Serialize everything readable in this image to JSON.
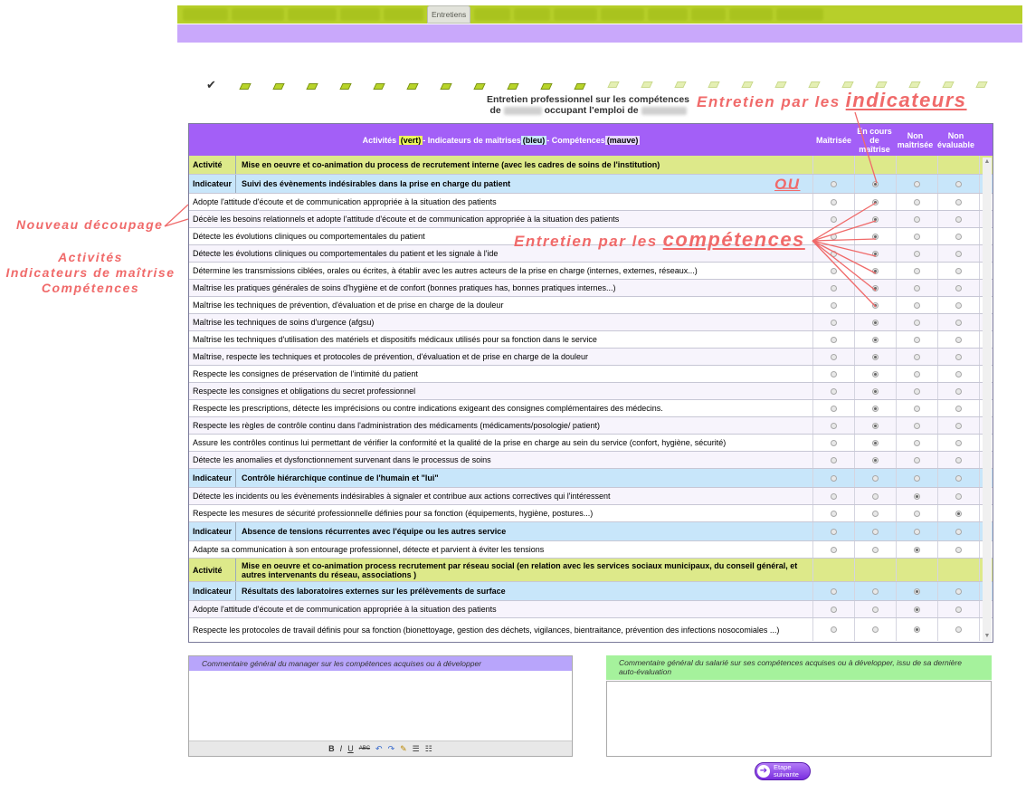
{
  "nav": {
    "tabs_blurred_count": 13,
    "active_tab": "Entretiens"
  },
  "header": {
    "line1": "Entretien professionnel sur les compétences",
    "line2_prefix": "de",
    "line2_mid": "occupant l'emploi de"
  },
  "table": {
    "title_prefix": "Activités",
    "title_hl1": "(vert)",
    "title_mid1": " - Indicateurs de maîtrises ",
    "title_hl2": "(bleu)",
    "title_mid2": " - Compétences ",
    "title_hl3": "(mauve)",
    "col_headers": [
      "Maîtrisée",
      "En cours de maîtrise",
      "Non maîtrisée",
      "Non évaluable"
    ],
    "rows": [
      {
        "type": "activite",
        "label": "Activité",
        "text": "Mise en oeuvre et co-animation du process de recrutement interne (avec les cadres de soins de l'institution)"
      },
      {
        "type": "indicateur",
        "label": "Indicateur",
        "text": "Suivi des évènements indésirables dans la prise en charge du patient",
        "sel": 1
      },
      {
        "type": "competence",
        "text": "Adopte l'attitude d'écoute et de communication appropriée à la situation des patients",
        "sel": 1
      },
      {
        "type": "competence",
        "text": "Décèle les besoins relationnels et adopte l'attitude d'écoute et de communication appropriée à la situation des patients",
        "sel": 1
      },
      {
        "type": "competence",
        "text": "Détecte les évolutions cliniques ou comportementales du patient",
        "sel": 1
      },
      {
        "type": "competence",
        "text": "Détecte les évolutions cliniques ou comportementales du patient et les signale à l'ide",
        "sel": 1
      },
      {
        "type": "competence",
        "text": "Détermine les transmissions ciblées, orales ou écrites, à établir avec les autres acteurs de la prise en charge (internes, externes, réseaux...)",
        "sel": 1
      },
      {
        "type": "competence",
        "text": "Maîtrise les pratiques générales de soins d'hygiène et de confort (bonnes pratiques has, bonnes pratiques internes...)",
        "sel": 1
      },
      {
        "type": "competence",
        "text": "Maîtrise les techniques de prévention, d'évaluation et de prise en charge de la douleur",
        "sel": 1
      },
      {
        "type": "competence",
        "text": "Maîtrise les techniques de soins d'urgence (afgsu)",
        "sel": 1
      },
      {
        "type": "competence",
        "text": "Maîtrise les techniques d'utilisation des matériels et dispositifs médicaux utilisés pour sa fonction dans le service",
        "sel": 1
      },
      {
        "type": "competence",
        "text": "Maîtrise, respecte les techniques et protocoles de prévention, d'évaluation et de prise en charge de la douleur",
        "sel": 1
      },
      {
        "type": "competence",
        "text": "Respecte les consignes de préservation de l'intimité du patient",
        "sel": 1
      },
      {
        "type": "competence",
        "text": "Respecte les consignes et obligations du secret professionnel",
        "sel": 1
      },
      {
        "type": "competence",
        "text": "Respecte les prescriptions, détecte les imprécisions ou contre indications exigeant des consignes complémentaires des médecins.",
        "sel": 1
      },
      {
        "type": "competence",
        "text": "Respecte les règles de contrôle continu dans l'administration des médicaments (médicaments/posologie/ patient)",
        "sel": 1
      },
      {
        "type": "competence",
        "text": "Assure les contrôles continus lui permettant de vérifier la conformité et la qualité de la prise en charge au sein du service (confort, hygiène, sécurité)",
        "sel": 1
      },
      {
        "type": "competence",
        "text": "Détecte les anomalies et dysfonctionnement survenant dans le processus de soins",
        "sel": 1
      },
      {
        "type": "indicateur",
        "label": "Indicateur",
        "text": "Contrôle hiérarchique continue de l'humain et \"lui\"",
        "sel": -1
      },
      {
        "type": "competence",
        "text": "Détecte les incidents ou les évènements indésirables à signaler et contribue aux actions correctives qui l'intéressent",
        "sel": 2
      },
      {
        "type": "competence",
        "text": "Respecte les mesures de sécurité professionnelle définies pour sa fonction (équipements, hygiène, postures...)",
        "sel": 3
      },
      {
        "type": "indicateur",
        "label": "Indicateur",
        "text": "Absence de tensions récurrentes avec l'équipe ou les autres service",
        "sel": -1
      },
      {
        "type": "competence",
        "text": "Adapte sa communication à son entourage professionnel, détecte et parvient à éviter les tensions",
        "sel": 2
      },
      {
        "type": "activite",
        "label": "Activité",
        "text": "Mise en oeuvre et co-animation process recrutement par réseau social (en relation avec les services sociaux municipaux, du conseil général, et autres intervenants du réseau, associations )",
        "tall": true
      },
      {
        "type": "indicateur",
        "label": "Indicateur",
        "text": "Résultats des laboratoires externes sur les prélèvements de surface",
        "sel": 2
      },
      {
        "type": "competence",
        "text": "Adopte l'attitude d'écoute et de communication appropriée à la situation des patients",
        "sel": 2
      },
      {
        "type": "competence",
        "text": "Respecte les protocoles de travail définis pour sa fonction (bionettoyage, gestion des déchets, vigilances, bientraitance, prévention des infections nosocomiales ...)",
        "sel": 2,
        "tall": true
      }
    ]
  },
  "annotations": {
    "indicateurs_prefix": "Entretien par les",
    "indicateurs_word": "indicateurs",
    "ou": "OU",
    "competences_prefix": "Entretien par les",
    "competences_word": "compétences",
    "nouveau": "Nouveau découpage",
    "list": [
      "Activités",
      "Indicateurs de maîtrise",
      "Compétences"
    ]
  },
  "comments": {
    "manager_header": "Commentaire général du manager sur les compétences acquises ou à développer",
    "employee_header": "Commentaire général du salarié sur ses compétences acquises ou à développer, issu de sa dernière auto-évaluation",
    "toolbar": [
      "B",
      "I",
      "U",
      "ABC",
      "↶",
      "↷",
      "✎",
      "☰",
      "☷"
    ]
  },
  "next_button": {
    "line1": "Etape",
    "line2": "suivante"
  },
  "colors": {
    "activite": "#dde98a",
    "indicateur": "#c8e6fa",
    "header": "#a35ff7",
    "annotation": "#f06a6a"
  }
}
